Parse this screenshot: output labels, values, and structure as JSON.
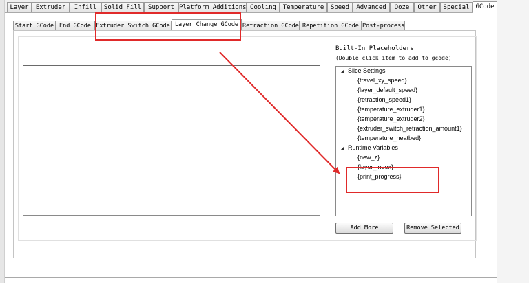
{
  "main_tabs": [
    {
      "label": "Layer"
    },
    {
      "label": "Extruder"
    },
    {
      "label": "Infill"
    },
    {
      "label": "Solid Fill"
    },
    {
      "label": "Support"
    },
    {
      "label": "Platform Additions"
    },
    {
      "label": "Cooling"
    },
    {
      "label": "Temperature"
    },
    {
      "label": "Speed"
    },
    {
      "label": "Advanced"
    },
    {
      "label": "Ooze"
    },
    {
      "label": "Other"
    },
    {
      "label": "Special"
    },
    {
      "label": "GCode"
    }
  ],
  "active_main_tab": "GCode",
  "sub_tabs": [
    {
      "label": "Start GCode"
    },
    {
      "label": "End GCode"
    },
    {
      "label": "Extruder Switch GCode"
    },
    {
      "label": "Layer Change GCode"
    },
    {
      "label": "Retraction GCode"
    },
    {
      "label": "Repetition GCode"
    },
    {
      "label": "Post-process"
    }
  ],
  "active_sub_tab": "Layer Change GCode",
  "placeholders": {
    "title": "Built-In Placeholders",
    "hint": "(Double click item to add to gcode)",
    "groups": [
      {
        "label": "Slice Settings",
        "items": [
          "{travel_xy_speed}",
          "{layer_default_speed}",
          "{retraction_speed1}",
          "{temperature_extruder1}",
          "{temperature_extruder2}",
          "{extruder_switch_retraction_amount1}",
          "{temperature_heatbed}"
        ]
      },
      {
        "label": "Runtime Variables",
        "items": [
          "{new_z}",
          "{layer_index}",
          "{print_progress}"
        ]
      }
    ]
  },
  "buttons": {
    "add_more": "Add More",
    "remove_selected": "Remove Selected"
  },
  "annotation_color": "#e02a2a"
}
